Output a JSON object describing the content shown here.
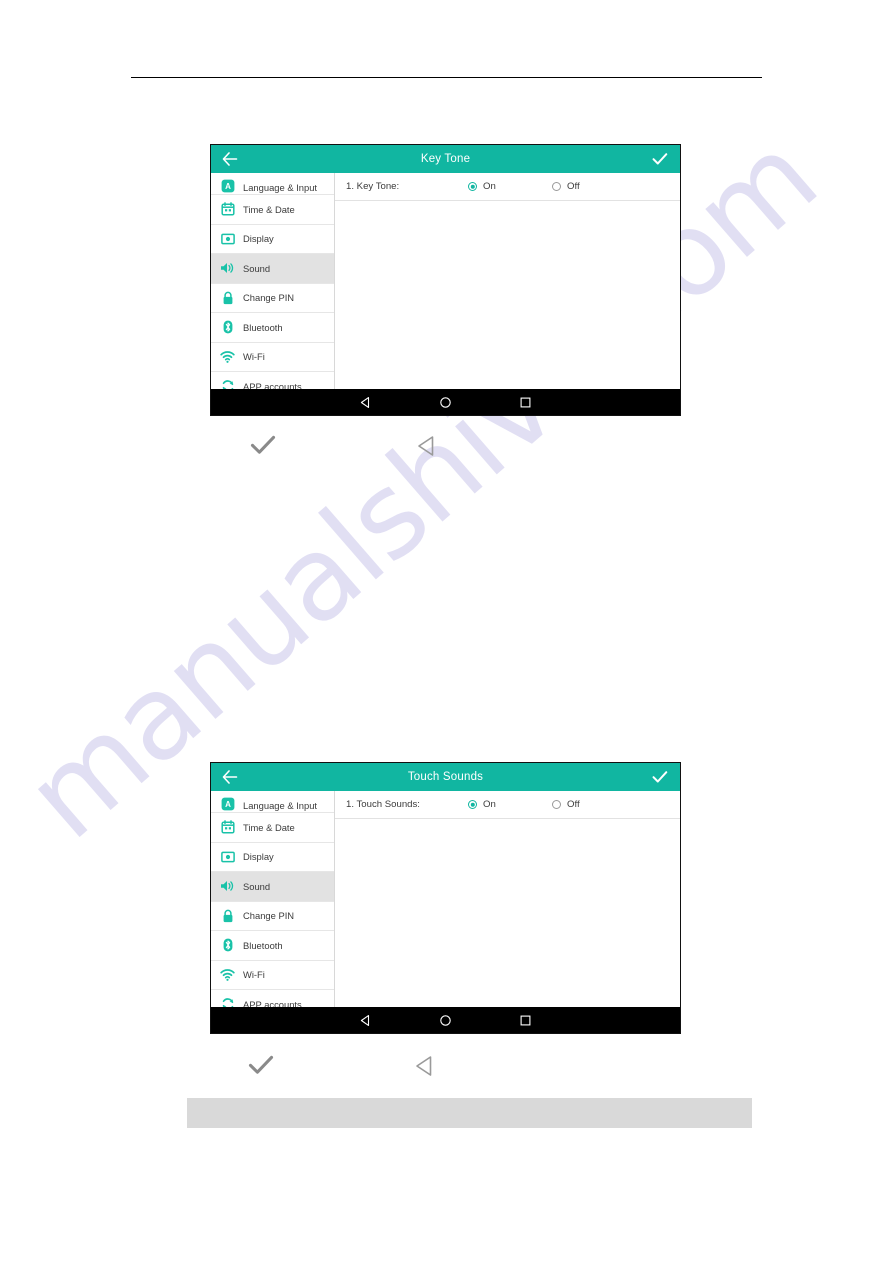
{
  "page": {
    "watermark": "manualshive.com"
  },
  "devices": [
    {
      "title": "Key Tone",
      "back_icon": "arrow-left-icon",
      "confirm_icon": "check-icon",
      "sidebar": [
        {
          "label": "Language & Input",
          "icon": "language-input-icon",
          "active": false
        },
        {
          "label": "Time & Date",
          "icon": "calendar-icon",
          "active": false
        },
        {
          "label": "Display",
          "icon": "display-icon",
          "active": false
        },
        {
          "label": "Sound",
          "icon": "speaker-icon",
          "active": true
        },
        {
          "label": "Change PIN",
          "icon": "lock-icon",
          "active": false
        },
        {
          "label": "Bluetooth",
          "icon": "bluetooth-icon",
          "active": false
        },
        {
          "label": "Wi-Fi",
          "icon": "wifi-icon",
          "active": false
        },
        {
          "label": "APP accounts",
          "icon": "sync-icon",
          "active": false
        }
      ],
      "setting": {
        "label": "1. Key Tone:",
        "options": [
          {
            "label": "On",
            "selected": true
          },
          {
            "label": "Off",
            "selected": false
          }
        ]
      },
      "navbar": [
        {
          "icon": "back-triangle-icon"
        },
        {
          "icon": "home-circle-icon"
        },
        {
          "icon": "recents-square-icon"
        }
      ],
      "caption_icons": [
        {
          "icon": "check-mark-icon"
        },
        {
          "icon": "back-triangle-outline-icon"
        }
      ]
    },
    {
      "title": "Touch Sounds",
      "back_icon": "arrow-left-icon",
      "confirm_icon": "check-icon",
      "sidebar": [
        {
          "label": "Language & Input",
          "icon": "language-input-icon",
          "active": false
        },
        {
          "label": "Time & Date",
          "icon": "calendar-icon",
          "active": false
        },
        {
          "label": "Display",
          "icon": "display-icon",
          "active": false
        },
        {
          "label": "Sound",
          "icon": "speaker-icon",
          "active": true
        },
        {
          "label": "Change PIN",
          "icon": "lock-icon",
          "active": false
        },
        {
          "label": "Bluetooth",
          "icon": "bluetooth-icon",
          "active": false
        },
        {
          "label": "Wi-Fi",
          "icon": "wifi-icon",
          "active": false
        },
        {
          "label": "APP accounts",
          "icon": "sync-icon",
          "active": false
        }
      ],
      "setting": {
        "label": "1. Touch Sounds:",
        "options": [
          {
            "label": "On",
            "selected": true
          },
          {
            "label": "Off",
            "selected": false
          }
        ]
      },
      "navbar": [
        {
          "icon": "back-triangle-icon"
        },
        {
          "icon": "home-circle-icon"
        },
        {
          "icon": "recents-square-icon"
        }
      ],
      "caption_icons": [
        {
          "icon": "check-mark-icon"
        },
        {
          "icon": "back-triangle-outline-icon"
        }
      ]
    }
  ],
  "colors": {
    "accent_teal": "#11b6a1",
    "selected_row": "#e2e2e2",
    "navbar_black": "#000000",
    "watermark": "#cfcced",
    "footer_bar": "#d9d9d9"
  }
}
